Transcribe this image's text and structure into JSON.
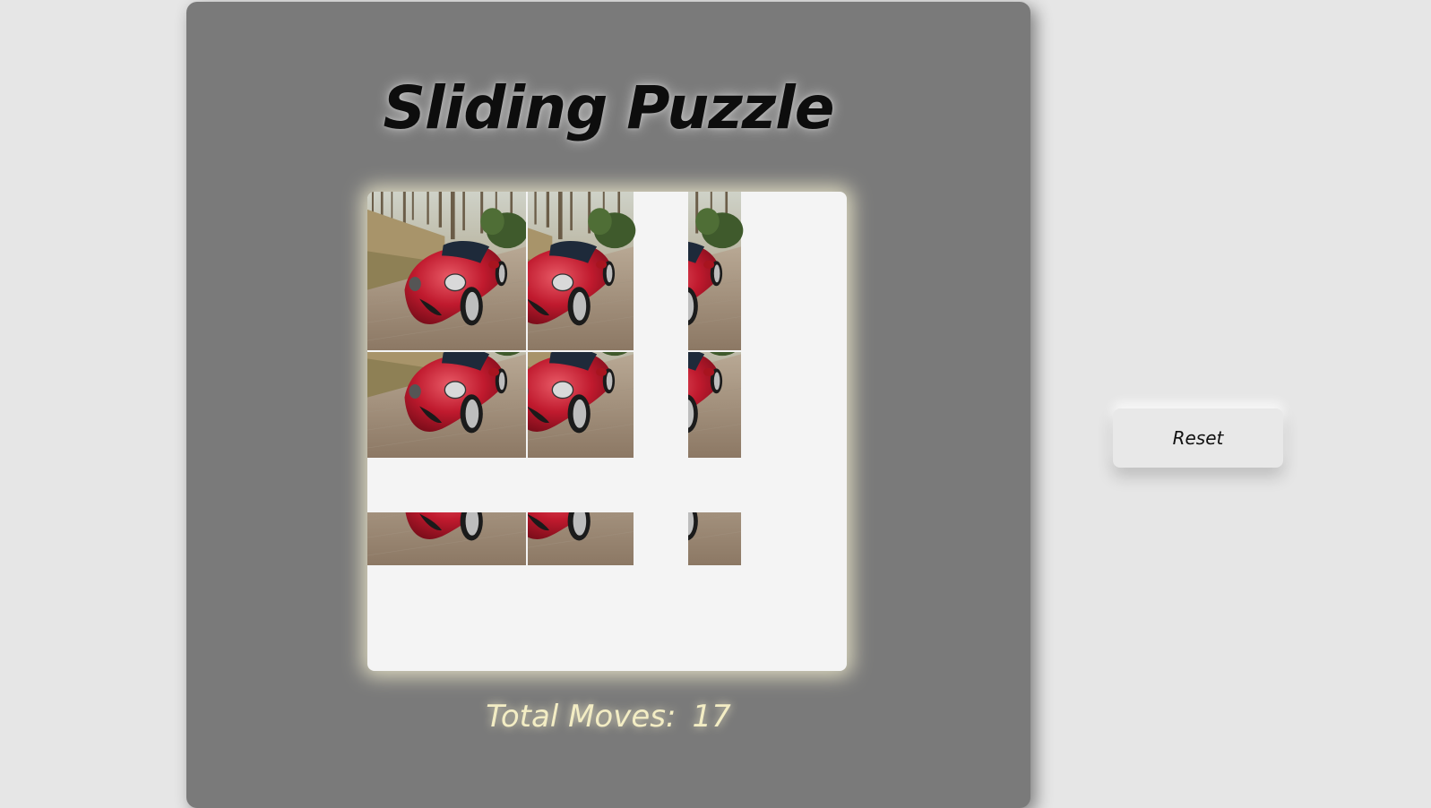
{
  "title": "Sliding Puzzle",
  "moves": {
    "label": "Total Moves:",
    "value": "17"
  },
  "reset_button": {
    "label": "Reset"
  },
  "board": {
    "rows": 3,
    "cols": 3,
    "image_subject": "red sports car on forest road"
  }
}
